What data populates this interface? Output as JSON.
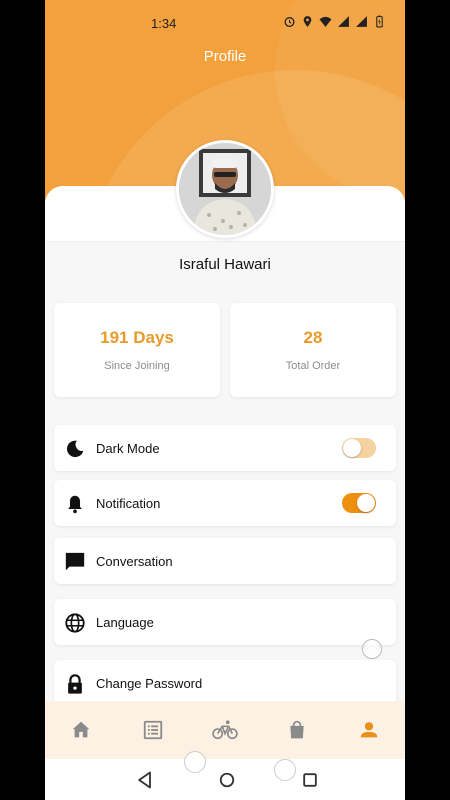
{
  "status_bar": {
    "time": "1:34",
    "icons": [
      "alarm-icon",
      "location-icon",
      "wifi-icon",
      "signal-icon",
      "signal-icon",
      "battery-icon"
    ]
  },
  "header": {
    "title": "Profile",
    "color": "#f3a13c"
  },
  "profile": {
    "name": "Israful Hawari"
  },
  "stats": [
    {
      "value": "191 Days",
      "label": "Since Joining"
    },
    {
      "value": "28",
      "label": "Total Order"
    }
  ],
  "settings": [
    {
      "label": "Dark Mode",
      "icon": "moon-icon",
      "toggle": false
    },
    {
      "label": "Notification",
      "icon": "bell-icon",
      "toggle": true
    },
    {
      "label": "Conversation",
      "icon": "chat-icon"
    },
    {
      "label": "Language",
      "icon": "globe-icon"
    },
    {
      "label": "Change Password",
      "icon": "lock-icon"
    }
  ],
  "bottom_nav": {
    "items": [
      "home-icon",
      "orders-list-icon",
      "bicycle-icon",
      "bag-icon",
      "profile-icon"
    ],
    "active": "profile-icon",
    "active_color": "#e8901a",
    "inactive_color": "#8a8a8a"
  },
  "accent_color": "#e89a2b"
}
